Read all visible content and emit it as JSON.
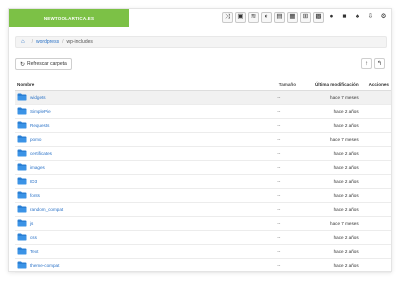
{
  "header": {
    "brand": "NEWTOOLARTICA.ES",
    "tools": [
      "shuffle-icon",
      "image-icon",
      "wifi-icon",
      "contrast-icon",
      "document-icon",
      "calendar-icon",
      "qr-icon",
      "grid-icon",
      "map-pin-icon",
      "folder-icon",
      "bell-icon",
      "download-icon",
      "gear-icon"
    ]
  },
  "breadcrumb": {
    "items": [
      "wordpress",
      "wp-includes"
    ]
  },
  "toolbar": {
    "refresh_label": "Refrescar carpeta"
  },
  "table": {
    "headers": {
      "name": "Nombre",
      "size": "Tamaño",
      "modified": "Última modificación",
      "actions": "Acciones"
    },
    "rows": [
      {
        "name": "widgets",
        "size": "--",
        "modified": "hace 7 meses"
      },
      {
        "name": "SimplePie",
        "size": "--",
        "modified": "hace 2 años"
      },
      {
        "name": "Requests",
        "size": "--",
        "modified": "hace 2 años"
      },
      {
        "name": "pomo",
        "size": "--",
        "modified": "hace 7 meses"
      },
      {
        "name": "certificates",
        "size": "--",
        "modified": "hace 2 años"
      },
      {
        "name": "images",
        "size": "--",
        "modified": "hace 2 años"
      },
      {
        "name": "ID3",
        "size": "--",
        "modified": "hace 2 años"
      },
      {
        "name": "fonts",
        "size": "--",
        "modified": "hace 2 años"
      },
      {
        "name": "random_compat",
        "size": "--",
        "modified": "hace 2 años"
      },
      {
        "name": "js",
        "size": "--",
        "modified": "hace 7 meses"
      },
      {
        "name": "css",
        "size": "--",
        "modified": "hace 2 años"
      },
      {
        "name": "Text",
        "size": "--",
        "modified": "hace 2 años"
      },
      {
        "name": "theme-compat",
        "size": "--",
        "modified": "hace 2 años"
      }
    ]
  },
  "colors": {
    "brand": "#7cc146",
    "folder": "#2a7fd4",
    "link": "#2a72c7"
  }
}
